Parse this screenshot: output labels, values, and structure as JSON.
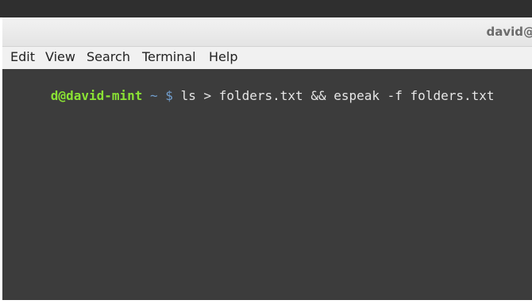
{
  "window": {
    "title": "david@"
  },
  "menu": {
    "items": [
      "Edit",
      "View",
      "Search",
      "Terminal",
      "Help"
    ]
  },
  "terminal": {
    "prompt_user": "d@david-mint",
    "prompt_dir": " ~ $ ",
    "command": "ls > folders.txt && espeak -f folders.txt"
  },
  "colors": {
    "terminal_bg": "#3c3c3c",
    "prompt_user": "#8ae234",
    "prompt_dir": "#729fcf",
    "command_text": "#e6e6e6"
  }
}
